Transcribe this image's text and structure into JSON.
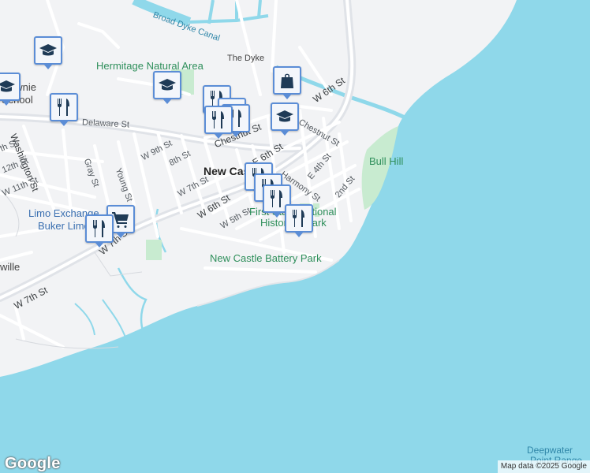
{
  "map": {
    "colors": {
      "water": "#8fd8ea",
      "land": "#f2f3f5",
      "park": "#c8ebd0",
      "road": "#ffffff",
      "major_road": "#e0e3e8",
      "pin_border": "#5b8dd6",
      "pin_icon": "#1f3b57"
    },
    "place_labels": {
      "new_castle": "New Castle",
      "bull_hill": "Bull Hill",
      "limo_exchange": "Limo Exchange",
      "buker_limo": "Buker Limo",
      "wille": "wille",
      "townie": "ownie",
      "school": "School",
      "deepwater": "Deepwater",
      "point_range": "Point Range"
    },
    "park_labels": {
      "hermitage": "Hermitage Natural Area",
      "first_state_1": "First State National",
      "first_state_2": "Historical Park",
      "battery_park": "New Castle Battery Park"
    },
    "water_labels": {
      "broad_dyke_canal": "Broad Dyke Canal",
      "the_dyke": "The Dyke"
    },
    "street_labels": {
      "delaware_st": "Delaware St",
      "washington_st": "Washington St",
      "w_7th_st": "W 7th St",
      "w_7th_st_2": "W 7th St",
      "w_7th_st_3": "W 7th St",
      "w_6th_st": "W 6th St",
      "w_6th_st_ne": "W 6th St",
      "e_6th_st": "E 6th St",
      "w_5th_st": "W 5th St",
      "w_9th_st": "W 9th St",
      "st_8th": "8th St",
      "gray_st": "Gray St",
      "young_st": "Young St",
      "chestnut_st": "Chestnut St",
      "chestnut_st_2": "Chestnut St",
      "harmony_st": "Harmony St",
      "e_4th_st": "E 4th St",
      "st_2nd": "2nd St",
      "w_12th_st": "12th St",
      "w_11th_st": "W 11th St",
      "th_st": "th St"
    },
    "pins": [
      {
        "icon": "school-icon"
      },
      {
        "icon": "school-icon"
      },
      {
        "icon": "school-icon"
      },
      {
        "icon": "restaurant-icon"
      },
      {
        "icon": "restaurant-icon"
      },
      {
        "icon": "restaurant-icon"
      },
      {
        "icon": "restaurant-icon"
      },
      {
        "icon": "restaurant-icon"
      },
      {
        "icon": "restaurant-icon"
      },
      {
        "icon": "restaurant-icon"
      },
      {
        "icon": "restaurant-icon"
      },
      {
        "icon": "restaurant-icon"
      },
      {
        "icon": "restaurant-icon"
      },
      {
        "icon": "shopping-bag-icon"
      },
      {
        "icon": "shopping-bag-icon"
      },
      {
        "icon": "shopping-cart-icon"
      },
      {
        "icon": "school-icon"
      }
    ],
    "attribution": "Map data ©2025 Google",
    "logo": "Google"
  }
}
